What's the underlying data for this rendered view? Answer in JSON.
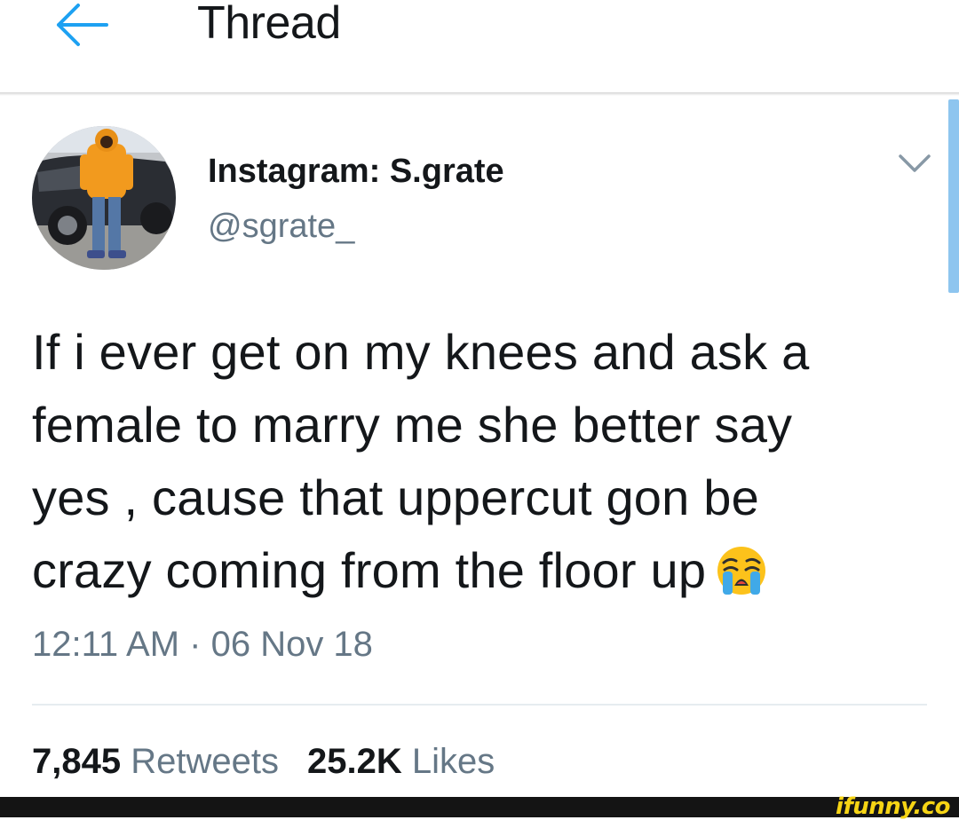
{
  "header": {
    "title": "Thread",
    "back_icon": "arrow-left-icon"
  },
  "tweet": {
    "display_name": "Instagram: S.grate",
    "handle": "@sgrate_",
    "text_lines": [
      "If i ever get on my knees and ask a",
      "female to marry me she better say",
      "yes , cause that uppercut gon be",
      "crazy coming from the floor up"
    ],
    "emoji": "loudly-crying-face-emoji",
    "timestamp": "12:11 AM · 06 Nov 18",
    "retweets_count": "7,845",
    "retweets_label": "Retweets",
    "likes_count": "25.2K",
    "likes_label": "Likes",
    "menu_icon": "chevron-down-icon"
  },
  "watermark": {
    "text": "ifunny.co"
  },
  "colors": {
    "accent": "#1da1f2",
    "text_primary": "#14171a",
    "text_secondary": "#657786",
    "divider": "#e6ecf0",
    "watermark": "#f6d414"
  }
}
